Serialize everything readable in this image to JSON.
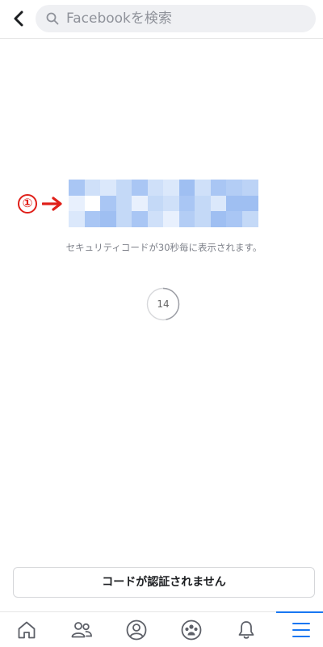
{
  "header": {
    "back_icon": "chevron-left-icon",
    "search": {
      "icon": "search-icon",
      "placeholder": "Facebookを検索",
      "value": ""
    }
  },
  "main": {
    "code_icon": "pixelated-code",
    "annotation_number": "①",
    "annotation_color": "#e0201a",
    "description": "セキュリティコードが30秒毎に表示されます。",
    "timer": {
      "value": "14",
      "remaining_fraction": 0.47
    },
    "code_not_verified_button": "コードが認証されません"
  },
  "tabbar": {
    "accent_color": "#1877f2",
    "tabs": [
      {
        "icon": "home-icon",
        "active": false
      },
      {
        "icon": "friends-icon",
        "active": false
      },
      {
        "icon": "profile-icon",
        "active": false
      },
      {
        "icon": "groups-icon",
        "active": false
      },
      {
        "icon": "bell-icon",
        "active": false
      },
      {
        "icon": "menu-icon",
        "active": true
      }
    ]
  }
}
